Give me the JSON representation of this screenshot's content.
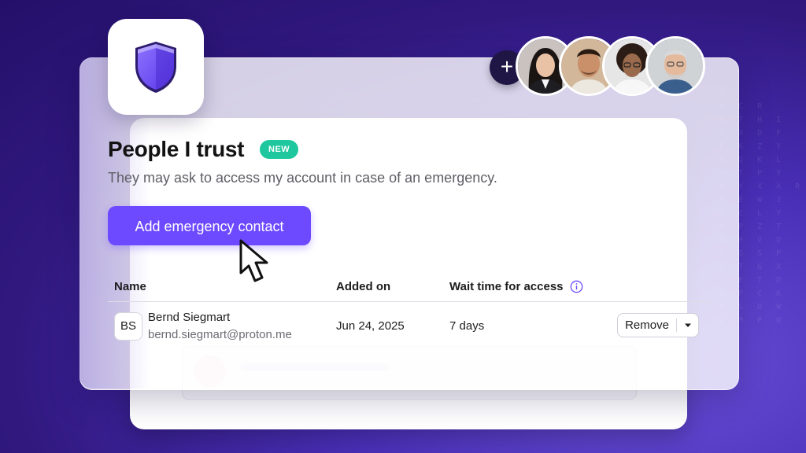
{
  "card": {
    "title": "People I trust",
    "badge": "NEW",
    "subtitle": "They may ask to access my account in case of an emergency.",
    "add_button_label": "Add emergency contact"
  },
  "avatars": {
    "add_label": "+",
    "people": [
      "person-1",
      "person-2",
      "person-3",
      "person-4"
    ]
  },
  "table": {
    "headers": [
      "Name",
      "Added on",
      "Wait time for access"
    ],
    "rows": [
      {
        "initials": "BS",
        "name": "Bernd Siegmart",
        "email": "bernd.siegmart@proton.me",
        "added_on": "Jun 24, 2025",
        "wait_time": "7 days",
        "action_label": "Remove"
      }
    ]
  },
  "colors": {
    "accent": "#6d4aff",
    "badge": "#1ec79e",
    "background": "#30187e"
  },
  "icons": [
    "shield-icon",
    "plus-icon",
    "info-icon",
    "chevron-down-icon",
    "cursor-icon"
  ]
}
